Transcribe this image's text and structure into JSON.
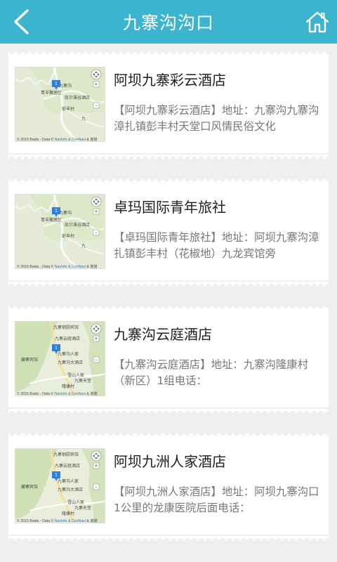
{
  "header": {
    "title": "九寨沟沟口",
    "back_icon": "chevron-left-icon",
    "home_icon": "home-icon",
    "color": "#3bb4cf"
  },
  "hotels": [
    {
      "name": "阿坝九寨彩云酒店",
      "description": "【阿坝九寨彩云酒店】地址：九寨沟九寨沟漳扎镇彭丰村天堂口风情民俗文化",
      "map": {
        "marker": "1",
        "labels": [
          "九寨沟",
          "青羊聚居区",
          "凯尔溪谷酒店",
          "彭丰村",
          "九"
        ],
        "credit_prefix": "© 2015 Baidu - Data ©",
        "credit_sources": [
          "NavInfo",
          "CenNavi",
          "道道"
        ]
      }
    },
    {
      "name": "卓玛国际青年旅社",
      "description": "【卓玛国际青年旅社】地址：阿坝九寨沟漳扎镇彭丰村（花椒地）九龙宾馆旁",
      "map": {
        "marker": "1",
        "labels": [
          "九寨沟",
          "青羊聚居区",
          "凯尔溪谷酒店",
          "彭丰村",
          "九"
        ],
        "credit_prefix": "© 2015 Baidu - Data ©",
        "credit_sources": [
          "NavInfo",
          "CenNavi",
          "道道"
        ]
      }
    },
    {
      "name": "九寨沟云庭酒店",
      "description": "【九寨沟云庭酒店】地址：九寨沟隆康村（新区）1组电话：",
      "map": {
        "marker": "1",
        "labels": [
          "九寨钢厨宾馆",
          "九寨云庭酒店",
          "藏寨宾馆",
          "九寨沟人家",
          "九寨沟大酒店",
          "雪山人家",
          "隆康村",
          "九寨天堂"
        ],
        "credit_prefix": "© 2015 Baidu - Data ©",
        "credit_sources": [
          "NavInfo",
          "CenNavi",
          "道道"
        ]
      }
    },
    {
      "name": "阿坝九洲人家酒店",
      "description": "【阿坝九洲人家酒店】地址：阿坝九寨沟口1公里的龙康医院后面电话：",
      "map": {
        "marker": "1",
        "labels": [
          "九寨钢厨宾馆",
          "九寨云庭酒店",
          "藏寨宾馆",
          "九寨沟人家",
          "九寨沟大酒店",
          "雪山人家",
          "隆康村",
          "九寨天堂"
        ],
        "credit_prefix": "© 2015 Baidu - Data ©",
        "credit_sources": [
          "NavInfo",
          "CenNavi",
          "道道"
        ]
      }
    }
  ]
}
